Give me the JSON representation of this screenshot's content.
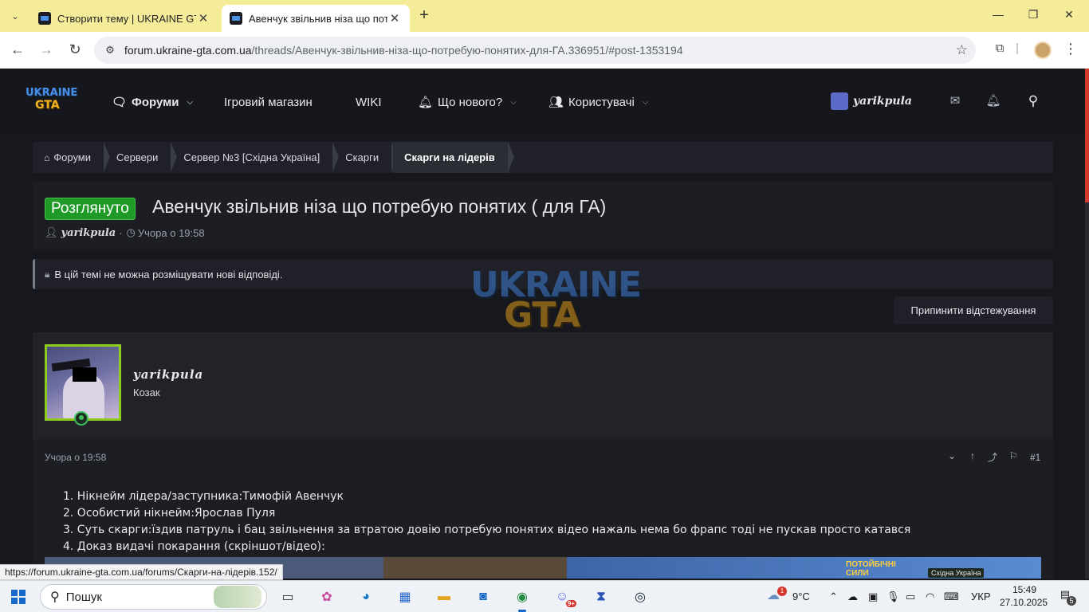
{
  "browser": {
    "tabs": [
      {
        "title": "Створити тему | UKRAINE GTA",
        "close": "✕"
      },
      {
        "title": "Авенчук звільнив ніза що потребую",
        "close": "✕"
      }
    ],
    "new_tab": "+",
    "url_host": "forum.ukraine-gta.com.ua",
    "url_path": "/threads/Авенчук-звільнив-ніза-що-потребую-понятих-для-ГА.336951/#post-1353194",
    "status_url": "https://forum.ukraine-gta.com.ua/forums/Скарги-на-лідерів.152/"
  },
  "site": {
    "logo_line1": "UKRAINE",
    "logo_line2": "GTA",
    "nav": [
      {
        "label": "Форуми",
        "icon": "chat-icon"
      },
      {
        "label": "Ігровий магазин"
      },
      {
        "label": "WIKI"
      },
      {
        "label": "Що нового?",
        "icon": "bell-icon"
      },
      {
        "label": "Користувачі",
        "icon": "users-icon"
      }
    ],
    "username": "yarikpula"
  },
  "breadcrumb": [
    "Форуми",
    "Сервери",
    "Сервер №3 [Східна Україна]",
    "Скарги",
    "Скарги на лідерів"
  ],
  "thread": {
    "status": "Розглянуто",
    "title": "Авенчук звільнив ніза що потребую понятих ( для ГА)",
    "author": "yarikpula",
    "date": "Учора о 19:58",
    "sep": "·"
  },
  "notice": "В цій темі не можна розміщувати нові відповіді.",
  "watermark": {
    "line1": "UKRAINE",
    "line2": "GTA"
  },
  "unwatch_label": "Припинити відстежування",
  "post": {
    "username": "yarikpula",
    "role": "Козак",
    "date": "Учора о 19:58",
    "number": "#1",
    "body": [
      "1. Нікнейм лідера/заступника:Тимофій Авенчук",
      "2. Особистий нікнейм:Ярослав Пуля",
      "3. Суть скарги:їздив патруль і бац звільнення за втратою довію потребую понятих відео нажаль нема бо фрапс тоді не пускав просто катався",
      "4. Доказ видачі покарання (скріншот/відео):"
    ],
    "image_labels": [
      "ПОТОЙБІЧНІ СИЛИ",
      "Східна Україна"
    ]
  },
  "taskbar": {
    "search_label": "Пошук",
    "weather": "9°C",
    "weather_badge": "1",
    "language": "УКР",
    "time": "15:49",
    "date": "27.10.2025",
    "discord_badge": "9+",
    "notifications": "5"
  },
  "colors": {
    "tabbar": "#f5ec9a",
    "page_bg": "#17181d",
    "status_green": "#1f9a27",
    "avatar_border": "#8ecc1c",
    "scroll_accent": "#d43b2f"
  }
}
